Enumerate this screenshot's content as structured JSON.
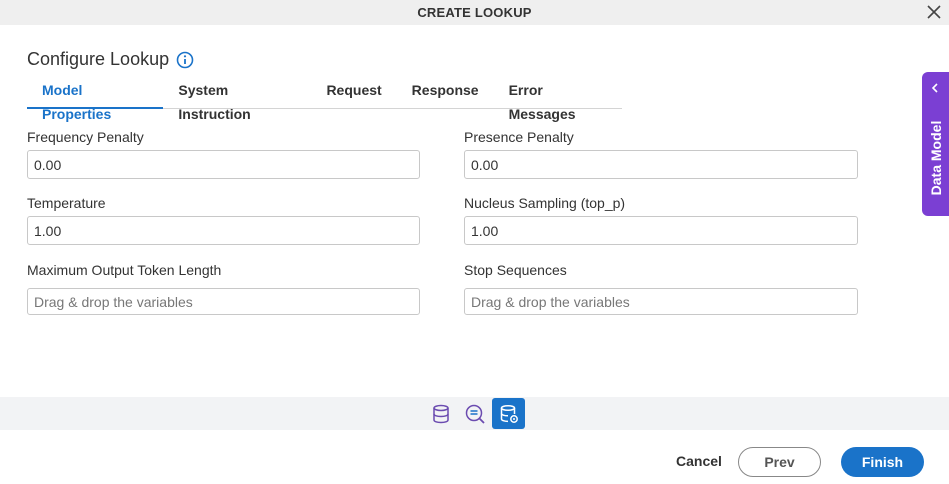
{
  "dialog": {
    "title": "CREATE LOOKUP"
  },
  "heading": {
    "title": "Configure Lookup"
  },
  "tabs": [
    {
      "label": "Model Properties",
      "active": true
    },
    {
      "label": "System Instruction",
      "active": false
    },
    {
      "label": "Request",
      "active": false
    },
    {
      "label": "Response",
      "active": false
    },
    {
      "label": "Error Messages",
      "active": false
    }
  ],
  "fields": {
    "frequency_penalty": {
      "label": "Frequency Penalty",
      "value": "0.00"
    },
    "presence_penalty": {
      "label": "Presence Penalty",
      "value": "0.00"
    },
    "temperature": {
      "label": "Temperature",
      "value": "1.00"
    },
    "nucleus_sampling": {
      "label": "Nucleus Sampling (top_p)",
      "value": "1.00"
    },
    "max_output_tokens": {
      "label": "Maximum Output Token Length",
      "value": "",
      "placeholder": "Drag & drop the variables"
    },
    "stop_sequences": {
      "label": "Stop Sequences",
      "value": "",
      "placeholder": "Drag & drop the variables"
    }
  },
  "side_panel": {
    "label": "Data Model"
  },
  "icon_bar": [
    {
      "icon": "database-icon",
      "active": false
    },
    {
      "icon": "search-list-icon",
      "active": false
    },
    {
      "icon": "database-settings-icon",
      "active": true
    }
  ],
  "footer": {
    "cancel_label": "Cancel",
    "prev_label": "Prev",
    "finish_label": "Finish"
  },
  "colors": {
    "accent": "#1a73c9",
    "side_panel": "#7b3fd3",
    "title_bar": "#efefef"
  }
}
